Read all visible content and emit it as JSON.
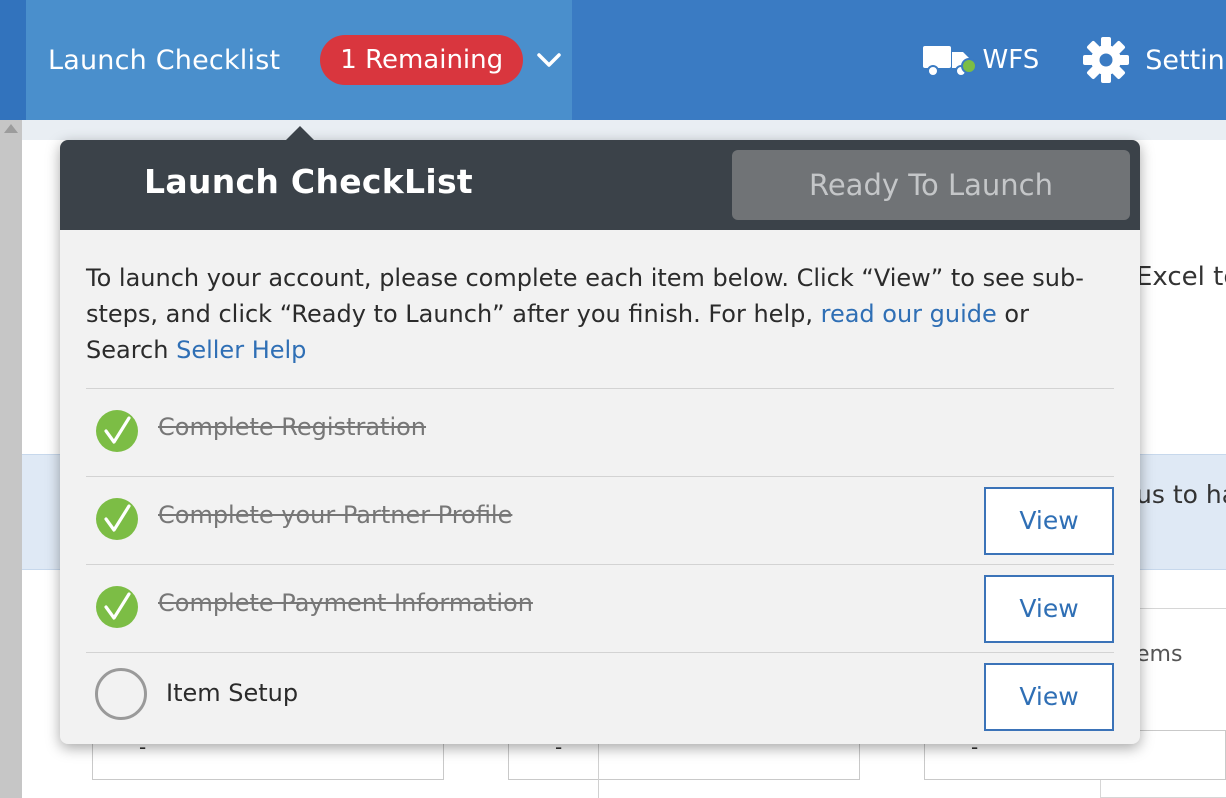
{
  "topbar": {
    "launch_label": "Launch Checklist",
    "remaining_badge": "1 Remaining",
    "wfs_label": "WFS",
    "settings_label": "Settings"
  },
  "background": {
    "text_1": "Excel te",
    "text_2": "us to ha",
    "text_3": "ems",
    "field_dash": "-"
  },
  "checklist": {
    "title": "Launch CheckList",
    "ready_button": "Ready To Launch",
    "desc_part1": "To launch your account, please complete each item below. Click “View” to see sub-steps, and click “Ready to Launch” after you finish. For help, ",
    "desc_link1": "read our guide",
    "desc_part2": " or Search ",
    "desc_link2": "Seller Help",
    "items": [
      {
        "label": "Complete Registration",
        "done": true
      },
      {
        "label": "Complete your Partner Profile",
        "done": true,
        "view_label": "View"
      },
      {
        "label": "Complete Payment Information",
        "done": true,
        "view_label": "View"
      },
      {
        "label": "Item Setup",
        "done": false,
        "view_label": "View"
      }
    ]
  },
  "colors": {
    "topbar": "#3a7bc3",
    "tab_active": "#4a8fcc",
    "badge": "#d9363e",
    "popover_header": "#3b4249",
    "check_green": "#7cbd45",
    "link": "#2f6fb5"
  }
}
